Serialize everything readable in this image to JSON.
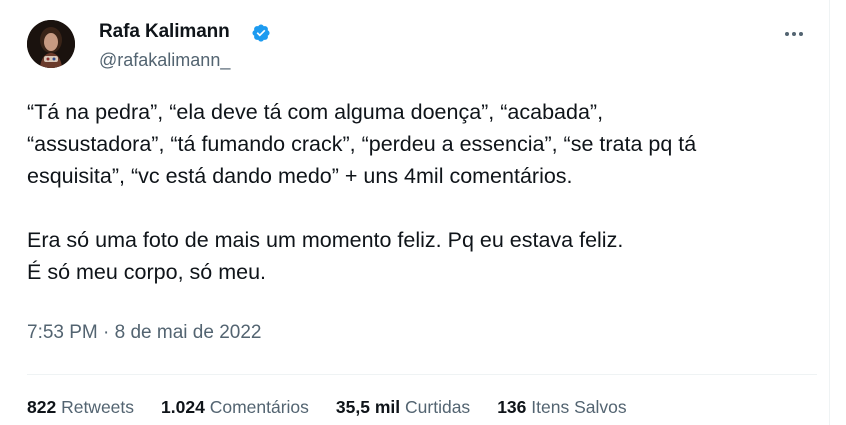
{
  "author": {
    "display_name": "Rafa Kalimann",
    "handle": "@rafakalimann_",
    "verified_icon": "verified-badge-icon",
    "verified_color": "#1d9bf0"
  },
  "menu_icon": "more-options-icon",
  "tweet": {
    "lines_p1": [
      "“Tá na pedra”, “ela deve tá com alguma doença”, “acabada”,",
      "“assustadora”, “tá fumando crack”, “perdeu a essencia”, “se trata pq tá",
      "esquisita”, “vc está dando medo” + uns 4mil comentários."
    ],
    "lines_p2": [
      "Era só uma foto de mais um momento feliz. Pq eu estava feliz.",
      "É só meu corpo, só meu."
    ]
  },
  "timestamp": "7:53 PM · 8 de mai de 2022",
  "stats": {
    "retweets": {
      "value": "822",
      "label": "Retweets"
    },
    "comments": {
      "value": "1.024",
      "label": "Comentários"
    },
    "likes": {
      "value": "35,5 mil",
      "label": "Curtidas"
    },
    "saves": {
      "value": "136",
      "label": "Itens Salvos"
    }
  },
  "colors": {
    "text_primary": "#0f1419",
    "text_secondary": "#536471",
    "divider": "#eff3f4"
  }
}
